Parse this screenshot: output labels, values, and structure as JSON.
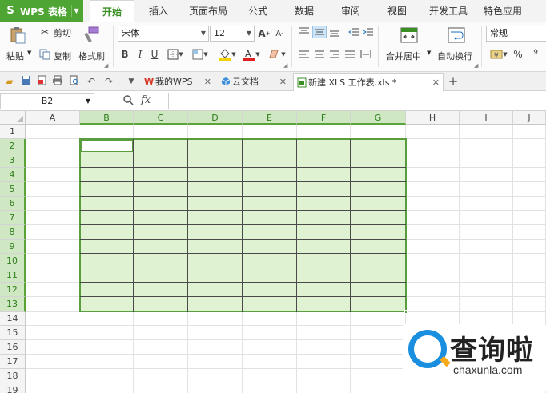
{
  "app": {
    "name": "WPS 表格"
  },
  "menu_tabs": [
    "开始",
    "插入",
    "页面布局",
    "公式",
    "数据",
    "审阅",
    "视图",
    "开发工具",
    "特色应用"
  ],
  "ribbon": {
    "paste": "粘贴",
    "cut": "剪切",
    "copy": "复制",
    "format_painter": "格式刷",
    "font_name": "宋体",
    "font_size": "12",
    "merge_center": "合并居中",
    "wrap_text": "自动换行",
    "number_format": "常规",
    "percent": "%",
    "comma": "⁹"
  },
  "doc_tabs": [
    {
      "label": "我的WPS",
      "active": false
    },
    {
      "label": "云文档",
      "active": false
    },
    {
      "label": "新建 XLS 工作表.xls *",
      "active": true
    }
  ],
  "formula_bar": {
    "name_box": "B2",
    "fx": "fx",
    "value": ""
  },
  "columns": [
    "A",
    "B",
    "C",
    "D",
    "E",
    "F",
    "G",
    "H",
    "I",
    "J"
  ],
  "rows": [
    "1",
    "2",
    "3",
    "4",
    "5",
    "6",
    "7",
    "8",
    "9",
    "10",
    "11",
    "12",
    "13",
    "14",
    "15",
    "16",
    "17",
    "18",
    "19"
  ],
  "selection": {
    "range": "B2:G13",
    "active_cell": "B2"
  },
  "watermark": {
    "brand": "查询啦",
    "url": "chaxunla.com"
  },
  "colors": {
    "accent_green": "#4ea534",
    "selection_fill": "#dff3d2",
    "selection_border": "#5a9d3e"
  }
}
